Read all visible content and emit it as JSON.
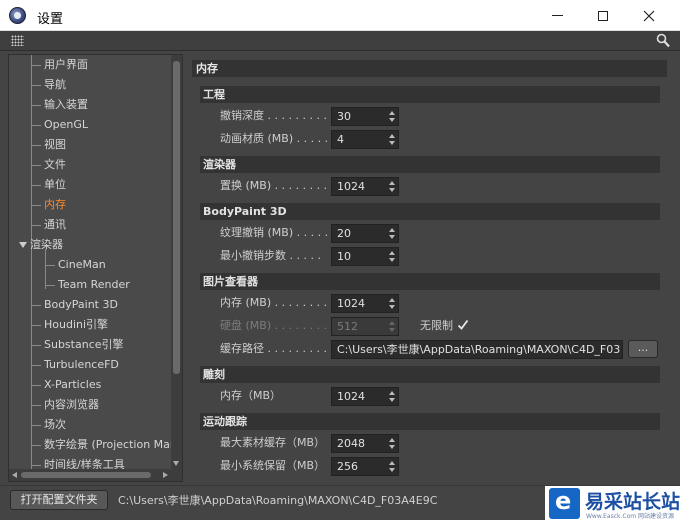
{
  "window": {
    "title": "设置"
  },
  "icons": {
    "app": "cinema4d-icon",
    "grip": "grip-icon",
    "search": "magnifier-icon",
    "spin": "spinner-arrows-icon",
    "check": "checkmark-icon"
  },
  "colors": {
    "active_item": "#ff8a2a",
    "panel_bg": "#444444",
    "header_bg": "#333333",
    "field_bg": "#2b2b2b"
  },
  "sidebar": {
    "items": [
      {
        "label": "用户界面",
        "level": 0
      },
      {
        "label": "导航",
        "level": 0
      },
      {
        "label": "输入装置",
        "level": 0
      },
      {
        "label": "OpenGL",
        "level": 0
      },
      {
        "label": "视图",
        "level": 0
      },
      {
        "label": "文件",
        "level": 0
      },
      {
        "label": "单位",
        "level": 0
      },
      {
        "label": "内存",
        "level": 0,
        "active": true
      },
      {
        "label": "通讯",
        "level": 0
      },
      {
        "label": "渲染器",
        "level": 0,
        "expanded": true
      },
      {
        "label": "CineMan",
        "level": 1
      },
      {
        "label": "Team Render",
        "level": 1
      },
      {
        "label": "BodyPaint 3D",
        "level": 0
      },
      {
        "label": "Houdini引擎",
        "level": 0
      },
      {
        "label": "Substance引擎",
        "level": 0
      },
      {
        "label": "TurbulenceFD",
        "level": 0
      },
      {
        "label": "X-Particles",
        "level": 0
      },
      {
        "label": "内容浏览器",
        "level": 0
      },
      {
        "label": "场次",
        "level": 0
      },
      {
        "label": "数字绘景 (Projection Man)",
        "level": 0
      },
      {
        "label": "时间线/样条工具",
        "level": 0
      }
    ]
  },
  "content": {
    "title": "内存",
    "groups": {
      "project": {
        "title": "工程",
        "undo_depth": {
          "label": "撤销深度",
          "value": "30"
        },
        "anim_material": {
          "label": "动画材质 (MB)",
          "value": "4"
        }
      },
      "renderer": {
        "title": "渲染器",
        "displace": {
          "label": "置换 (MB)",
          "value": "1024"
        }
      },
      "bodypaint": {
        "title": "BodyPaint 3D",
        "texture_undo": {
          "label": "纹理撤销 (MB)",
          "value": "20"
        },
        "min_undo_steps": {
          "label": "最小撤销步数",
          "value": "10"
        }
      },
      "picture_viewer": {
        "title": "图片查看器",
        "memory": {
          "label": "内存 (MB)",
          "value": "1024"
        },
        "disk": {
          "label": "硬盘 (MB)",
          "value": "512"
        },
        "unlimited": {
          "label": "无限制",
          "checked": true
        },
        "cache_path": {
          "label": "缓存路径",
          "value": "C:\\Users\\李世康\\AppData\\Roaming\\MAXON\\C4D_F03",
          "browse": "..."
        }
      },
      "sculpt": {
        "title": "雕刻",
        "memory": {
          "label": "内存（MB）",
          "value": "1024"
        }
      },
      "motion_tracking": {
        "title": "运动跟踪",
        "max_footage_cache": {
          "label": "最大素材缓存（MB）",
          "value": "2048"
        },
        "min_system_reserve": {
          "label": "最小系统保留（MB）",
          "value": "256"
        }
      }
    }
  },
  "footer": {
    "open_folder_label": "打开配置文件夹",
    "path": "C:\\Users\\李世康\\AppData\\Roaming\\MAXON\\C4D_F03A4E9C"
  },
  "watermark": {
    "text": "易采站长站",
    "url": "Www.Easck.Com 网站建设资源"
  }
}
